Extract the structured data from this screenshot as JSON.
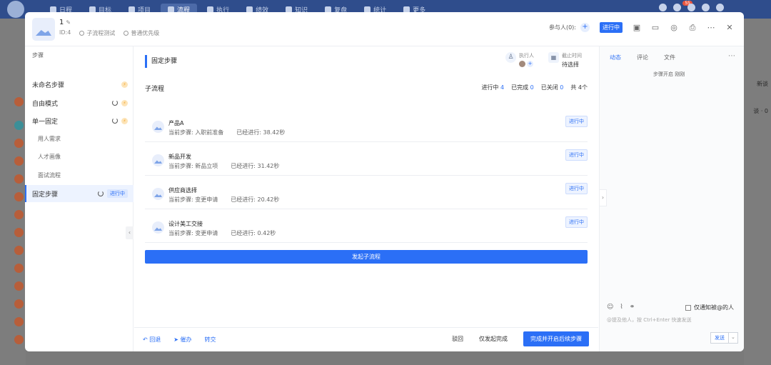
{
  "background": {
    "nav": [
      {
        "label": "日程"
      },
      {
        "label": "目标"
      },
      {
        "label": "项目"
      },
      {
        "label": "流程"
      },
      {
        "label": "执行"
      },
      {
        "label": "绩效"
      },
      {
        "label": "知识"
      },
      {
        "label": "复盘"
      },
      {
        "label": "统计"
      },
      {
        "label": "更多"
      }
    ],
    "notification_count": "55",
    "right_labels": [
      "新谈",
      "谈 · 0"
    ]
  },
  "header": {
    "title": "1",
    "id_text": "ID:4",
    "meta": [
      "子流程测试",
      "普通优先级"
    ],
    "participants_label": "参与人(0):",
    "status": "进行中"
  },
  "steps": {
    "title": "步骤",
    "items": [
      {
        "label": "未命名步骤"
      },
      {
        "label": "自由模式"
      },
      {
        "label": "单一固定"
      },
      {
        "label": "用人需求"
      },
      {
        "label": "人才画像"
      },
      {
        "label": "面试流程"
      },
      {
        "label": "固定步骤",
        "tag": "进行中"
      }
    ]
  },
  "main": {
    "section_title": "固定步骤",
    "executor_label": "执行人",
    "deadline_label": "截止时间",
    "deadline_value": "待选择",
    "subflow_title": "子流程",
    "stats": {
      "running_label": "进行中",
      "running": "4",
      "done_label": "已完成",
      "done": "0",
      "closed_label": "已关闭",
      "closed": "0",
      "total": "共 4个"
    },
    "subflows": [
      {
        "name": "产品A",
        "step": "当前步骤: 入职前准备",
        "elapsed": "已经进行: 38.42秒",
        "tag": "进行中"
      },
      {
        "name": "新品开发",
        "step": "当前步骤: 新品立项",
        "elapsed": "已经进行: 31.42秒",
        "tag": "进行中"
      },
      {
        "name": "供应商选择",
        "step": "当前步骤: 变更申请",
        "elapsed": "已经进行: 20.42秒",
        "tag": "进行中"
      },
      {
        "name": "设计美工交接",
        "step": "当前步骤: 变更申请",
        "elapsed": "已经进行: 0.42秒",
        "tag": "进行中"
      }
    ],
    "launch_button": "发起子流程",
    "footer": {
      "rollback": "回退",
      "urge": "催办",
      "transfer": "转交",
      "reject": "驳回",
      "complete_only": "仅发起完成",
      "complete_next": "完成并开启后续步骤"
    }
  },
  "rpanel": {
    "tabs": [
      "动态",
      "评论",
      "文件"
    ],
    "note": "步骤开启 刚刚",
    "only_notify": "仅通知被@的人",
    "placeholder": "@提及他人，按 Ctrl+Enter 快速发送",
    "send": "发送"
  },
  "colors": {
    "accent": "#2b6ff6",
    "topbar": "#2f4d8c"
  }
}
